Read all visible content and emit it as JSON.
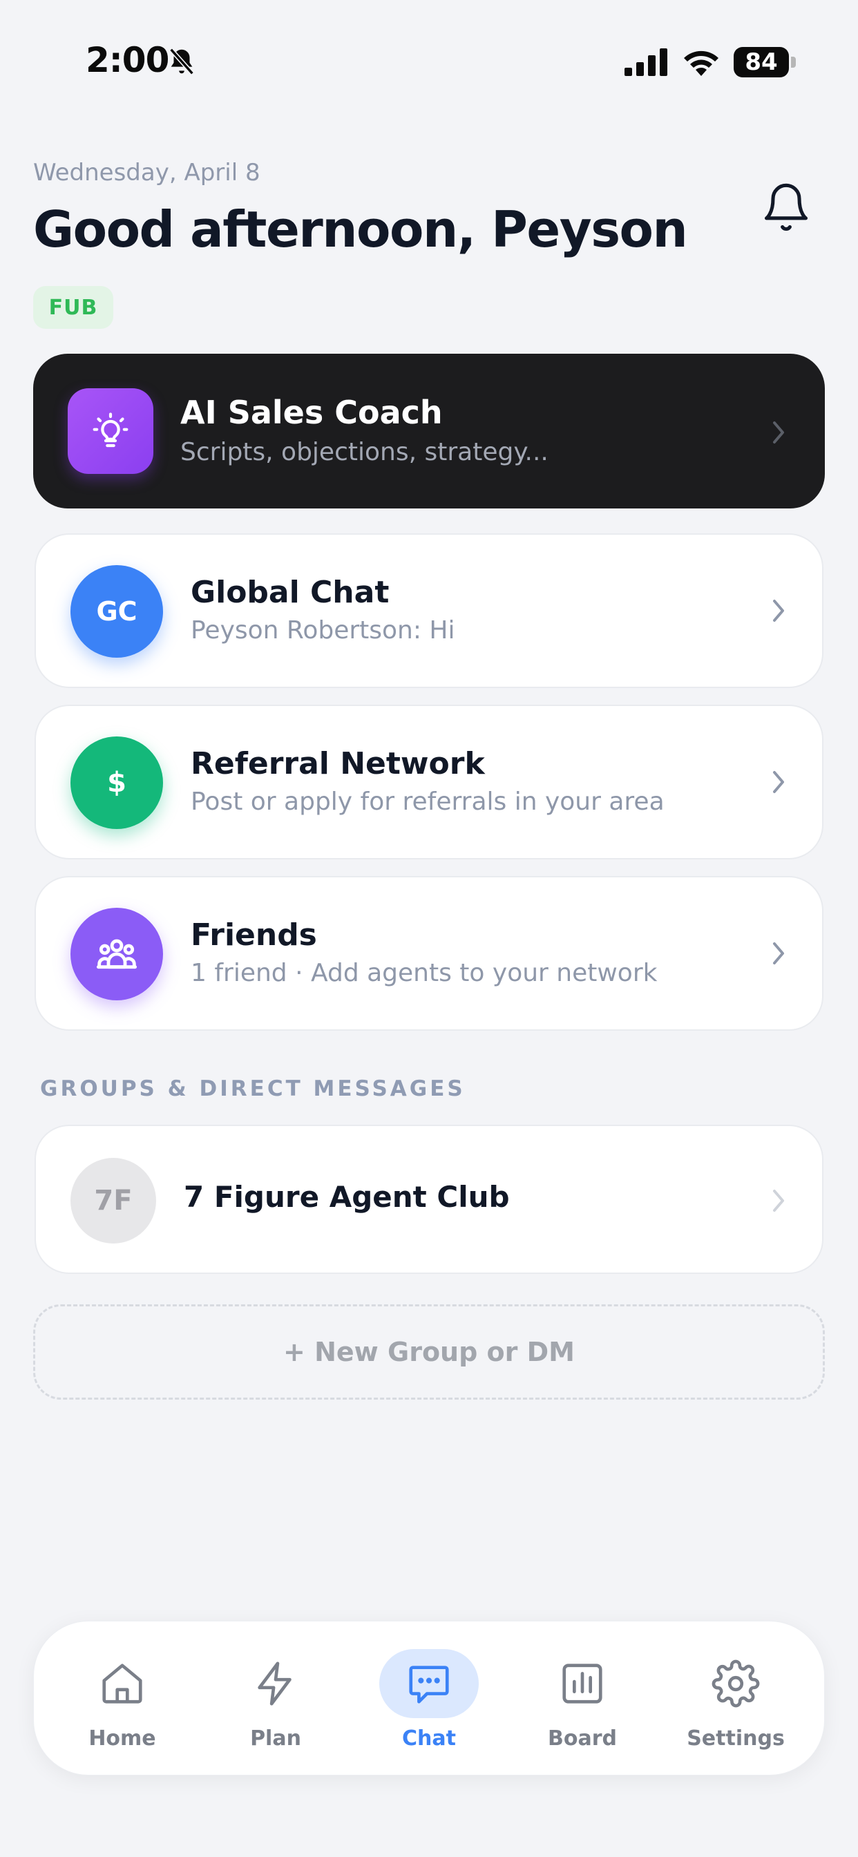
{
  "status_bar": {
    "time": "2:00",
    "battery_level": "84"
  },
  "header": {
    "date": "Wednesday, April 8",
    "greeting": "Good afternoon, Peyson",
    "badge": "FUB"
  },
  "coach": {
    "title": "AI Sales Coach",
    "subtitle": "Scripts, objections, strategy..."
  },
  "cards": [
    {
      "avatar_text": "GC",
      "title": "Global Chat",
      "subtitle": "Peyson Robertson: Hi",
      "color": "#3b82f6"
    },
    {
      "avatar_text": "$",
      "title": "Referral Network",
      "subtitle": "Post or apply for referrals in your area",
      "color": "#10b981"
    },
    {
      "avatar_text": "",
      "title": "Friends",
      "subtitle": "1 friend · Add agents to your network",
      "color": "#8b5cf6"
    }
  ],
  "groups": {
    "section_label": "GROUPS & DIRECT MESSAGES",
    "items": [
      {
        "avatar_text": "7F",
        "title": "7 Figure Agent Club"
      }
    ],
    "new_button": "+ New Group or DM"
  },
  "tabbar": {
    "items": [
      {
        "label": "Home",
        "icon": "home-icon"
      },
      {
        "label": "Plan",
        "icon": "lightning-icon"
      },
      {
        "label": "Chat",
        "icon": "chat-icon",
        "active": true
      },
      {
        "label": "Board",
        "icon": "bar-chart-icon"
      },
      {
        "label": "Settings",
        "icon": "gear-icon"
      }
    ]
  },
  "colors": {
    "accent": "#3b82f6",
    "badge_green": "#2fb957",
    "coach_purple": "#a855f7"
  }
}
